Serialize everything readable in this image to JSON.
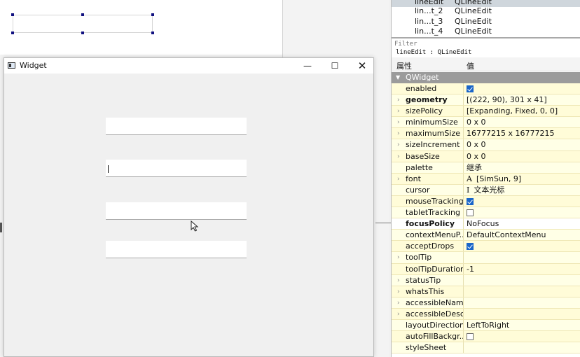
{
  "preview": {
    "title": "Widget",
    "min_glyph": "—",
    "max_glyph": "☐",
    "close_glyph": "✕",
    "line_edits": [
      "",
      "",
      "",
      ""
    ]
  },
  "inspector": {
    "objects": [
      {
        "name": "lineEdit",
        "class": "QLineEdit"
      },
      {
        "name": "lin...t_2",
        "class": "QLineEdit"
      },
      {
        "name": "lin...t_3",
        "class": "QLineEdit"
      },
      {
        "name": "lin...t_4",
        "class": "QLineEdit"
      }
    ]
  },
  "property_editor": {
    "filter_placeholder": "Filter",
    "object_label": "lineEdit : QLineEdit",
    "header_name": "属性",
    "header_value": "值",
    "section": "QWidget",
    "properties": [
      {
        "name": "enabled",
        "value": "",
        "checkbox": true,
        "expandable": false,
        "bold": false
      },
      {
        "name": "geometry",
        "value": "[(222, 90), 301 x 41]",
        "checkbox": null,
        "expandable": true,
        "bold": true
      },
      {
        "name": "sizePolicy",
        "value": "[Expanding, Fixed, 0, 0]",
        "checkbox": null,
        "expandable": true,
        "bold": false
      },
      {
        "name": "minimumSize",
        "value": "0 x 0",
        "checkbox": null,
        "expandable": true,
        "bold": false
      },
      {
        "name": "maximumSize",
        "value": "16777215 x 16777215",
        "checkbox": null,
        "expandable": true,
        "bold": false
      },
      {
        "name": "sizeIncrement",
        "value": "0 x 0",
        "checkbox": null,
        "expandable": true,
        "bold": false
      },
      {
        "name": "baseSize",
        "value": "0 x 0",
        "checkbox": null,
        "expandable": true,
        "bold": false
      },
      {
        "name": "palette",
        "value": "继承",
        "checkbox": null,
        "expandable": false,
        "bold": false
      },
      {
        "name": "font",
        "value": "[SimSun, 9]",
        "icon": "A",
        "checkbox": null,
        "expandable": true,
        "bold": false
      },
      {
        "name": "cursor",
        "value": "文本光标",
        "icon": "I",
        "checkbox": null,
        "expandable": false,
        "bold": false
      },
      {
        "name": "mouseTracking",
        "value": "",
        "checkbox": true,
        "expandable": false,
        "bold": false
      },
      {
        "name": "tabletTracking",
        "value": "",
        "checkbox": false,
        "expandable": false,
        "bold": false
      },
      {
        "name": "focusPolicy",
        "value": "NoFocus",
        "checkbox": null,
        "expandable": false,
        "bold": true
      },
      {
        "name": "contextMenuP...",
        "value": "DefaultContextMenu",
        "checkbox": null,
        "expandable": false,
        "bold": false
      },
      {
        "name": "acceptDrops",
        "value": "",
        "checkbox": true,
        "expandable": false,
        "bold": false
      },
      {
        "name": "toolTip",
        "value": "",
        "checkbox": null,
        "expandable": true,
        "bold": false
      },
      {
        "name": "toolTipDuration",
        "value": "-1",
        "checkbox": null,
        "expandable": false,
        "bold": false
      },
      {
        "name": "statusTip",
        "value": "",
        "checkbox": null,
        "expandable": true,
        "bold": false
      },
      {
        "name": "whatsThis",
        "value": "",
        "checkbox": null,
        "expandable": true,
        "bold": false
      },
      {
        "name": "accessibleName",
        "value": "",
        "checkbox": null,
        "expandable": true,
        "bold": false
      },
      {
        "name": "accessibleDesc...",
        "value": "",
        "checkbox": null,
        "expandable": true,
        "bold": false
      },
      {
        "name": "layoutDirection",
        "value": "LeftToRight",
        "checkbox": null,
        "expandable": false,
        "bold": false
      },
      {
        "name": "autoFillBackgr...",
        "value": "",
        "checkbox": false,
        "expandable": false,
        "bold": false
      },
      {
        "name": "styleSheet",
        "value": "",
        "checkbox": null,
        "expandable": false,
        "bold": false
      }
    ]
  }
}
